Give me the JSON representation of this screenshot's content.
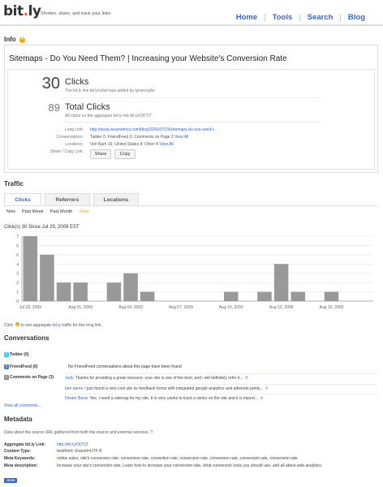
{
  "brand": {
    "logo_main": "bit",
    "logo_dot": ".",
    "logo_tail": "ly",
    "tagline": "Shorten, share, and track your links"
  },
  "nav": {
    "items": [
      "Home",
      "Tools",
      "Search",
      "Blog"
    ],
    "separator": "|"
  },
  "info": {
    "title": "Info",
    "page_heading": "Sitemaps - Do You Need Them? | Increasing your Website's Conversion Rate",
    "clicks": {
      "value": "30",
      "label": "Clicks",
      "note": "The bit.ly link bit.ly/u0wf was added by lgrancoglio"
    },
    "total_clicks": {
      "value": "89",
      "label": "Total Clicks",
      "note": "All clicks on the aggregate bit.ly link bit.ly/ODTjT"
    },
    "rows": [
      {
        "label": "Long Link:",
        "value": "http://www.lunametrics.com/blog/2009/07/29/sitemaps-do-you-need-t...",
        "link": true
      },
      {
        "label": "Conversations:",
        "value": "Twitter 0; FriendFeed 0; Comments on Page 3",
        "extra": "View All"
      },
      {
        "label": "Locations:",
        "value": "Viet Nam 16; United States 8; Other 4",
        "extra": "View All"
      },
      {
        "label": "Share / Copy Link:",
        "value": ""
      }
    ],
    "share_label": "Share",
    "copy_label": "Copy"
  },
  "traffic": {
    "title": "Traffic",
    "tabs": [
      "Clicks",
      "Referrers",
      "Locations"
    ],
    "ranges": [
      "Now",
      "Past Week",
      "Past Month",
      "Total"
    ],
    "clicks_since": "Click(s) 30 Since Jul 29, 2009 EST",
    "help_prefix": "Click",
    "help_middle": "to see aggregate",
    "help_link": "bit.ly",
    "help_suffix": "traffic for this long link."
  },
  "chart_data": {
    "type": "bar",
    "categories": [
      "Jul 29",
      "Jul 30",
      "Jul 31",
      "Aug 01",
      "Aug 02",
      "Aug 03",
      "Aug 04",
      "Aug 05",
      "Aug 06",
      "Aug 07",
      "Aug 08",
      "Aug 09",
      "Aug 10",
      "Aug 11",
      "Aug 12",
      "Aug 13",
      "Aug 14",
      "Aug 15",
      "Aug 16",
      "Aug 17",
      "Aug 18"
    ],
    "values": [
      7,
      5,
      2,
      2,
      0,
      2,
      3,
      1,
      0,
      0,
      0,
      0,
      1,
      0,
      1,
      4,
      1,
      0,
      1,
      0,
      0
    ],
    "ylim": [
      0,
      7
    ],
    "yticks": [
      "0",
      "1",
      "2",
      "3",
      "4",
      "5",
      "6",
      "7"
    ],
    "xtick_labels": [
      {
        "index": 0,
        "label": "Jul 29, 2009"
      },
      {
        "index": 3,
        "label": "Aug 01, 2009"
      },
      {
        "index": 6,
        "label": "Aug 04, 2009"
      },
      {
        "index": 9,
        "label": "Aug 07, 2009"
      },
      {
        "index": 12,
        "label": "Aug 10, 2009"
      },
      {
        "index": 15,
        "label": "Aug 13, 2009"
      },
      {
        "index": 18,
        "label": "Aug 16, 2009"
      }
    ],
    "bar_color": "#999999",
    "grid": true
  },
  "conversations": {
    "title": "Conversations",
    "twitter_label": "Twitter (0)",
    "friendfeed_label": "FriendFeed (0)",
    "friendfeed_note": "No FriendFeed conversations about this page have been found",
    "comments_label": "Comments on Page (3)",
    "comments": [
      {
        "author": "Judy",
        "text": "Thanks for providing a great resource. your site is one of the best, and i will definitely refer it...",
        "hash": "#"
      },
      {
        "author": "ben dame",
        "text": "I just found a very cool site its feedback forms with integrated google analytics and adwords pretty...",
        "hash": "#"
      },
      {
        "author": "Dexter Bosie",
        "text": "Yes, I need a sitemap for my site. It is very useful to track a visitor on the site and it is import...",
        "hash": "#"
      }
    ],
    "view_all": "View all comments..."
  },
  "metadata": {
    "title": "Metadata",
    "description": "Data about the source URL gathered from both the source and external services.",
    "help_icon": "?",
    "fields": [
      {
        "label": "Aggregate bit.ly Link:",
        "value": "http://bit.ly/ODTjT",
        "link": true
      },
      {
        "label": "Content Type:",
        "value": "text/html; charset=UTF-8"
      },
      {
        "label": "Meta Keywords:",
        "value": "online sales, site's conversion rate, conversion rate, convertion rate, conversion rate, conversion rate, conversion rate, conversion rate"
      },
      {
        "label": "Meta description:",
        "value": "Increase your site's conversion rate. Learn how to increase your conversion rate, what conversion tools you should use, and all about web analytics."
      }
    ],
    "json_label": "JSON"
  },
  "colors": {
    "link": "#3366cc",
    "accent": "#f0a30a",
    "bar": "#999999"
  }
}
